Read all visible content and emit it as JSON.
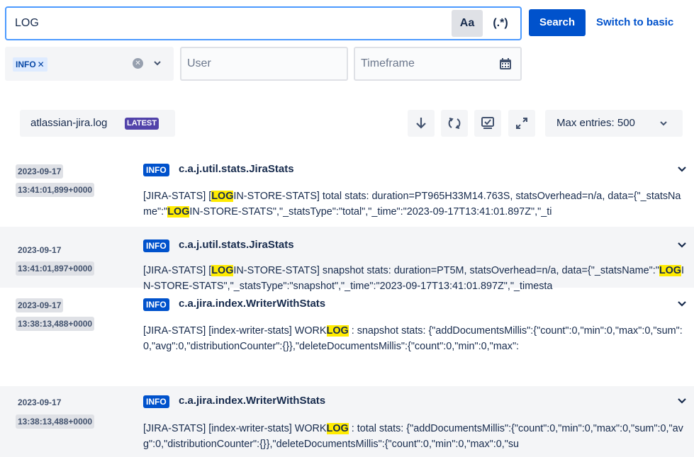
{
  "search": {
    "query": "LOG",
    "case_sensitive_label": "Aa",
    "regex_label": "(.*)",
    "search_button": "Search",
    "switch_link": "Switch to basic"
  },
  "filters": {
    "level_tag": "INFO",
    "level_tag_remove": "✕",
    "user_placeholder": "User",
    "timeframe_placeholder": "Timeframe"
  },
  "toolbar": {
    "file_name": "atlassian-jira.log",
    "latest_badge": "LATEST",
    "icons": [
      "download-icon",
      "refresh-icon",
      "monitor-icon",
      "expand-icon"
    ],
    "max_entries_label": "Max entries: 500"
  },
  "entries": [
    {
      "date": "2023-09-17",
      "time": "13:41:01,899+0000",
      "level": "INFO",
      "logger": "c.a.j.util.stats.JiraStats",
      "msg": {
        "a": "[JIRA-STATS] [",
        "b": "LOG",
        "c": "IN-STORE-STATS] total stats: duration=PT965H33M14.763S, statsOverhead=n/a, data={\"_statsName\":\"",
        "d": "LOG",
        "e": "IN-STORE-STATS\",\"_statsType\":\"total\",\"_time\":\"2023-09-17T13:41:01.897Z\",\"_ti"
      }
    },
    {
      "date": "2023-09-17",
      "time": "13:41:01,897+0000",
      "level": "INFO",
      "logger": "c.a.j.util.stats.JiraStats",
      "msg": {
        "a": "[JIRA-STATS] [",
        "b": "LOG",
        "c": "IN-STORE-STATS] snapshot stats: duration=PT5M, statsOverhead=n/a, data={\"_statsName\":\"",
        "d": "LOG",
        "e": "IN-STORE-STATS\",\"_statsType\":\"snapshot\",\"_time\":\"2023-09-17T13:41:01.897Z\",\"_timesta"
      }
    },
    {
      "date": "2023-09-17",
      "time": "13:38:13,488+0000",
      "level": "INFO",
      "logger": "c.a.jira.index.WriterWithStats",
      "msg": {
        "a": "[JIRA-STATS] [index-writer-stats] WORK",
        "b": "LOG",
        "c": " : snapshot stats: {\"addDocumentsMillis\":{\"count\":0,\"min\":0,\"max\":0,\"sum\":0,\"avg\":0,\"distributionCounter\":{}},\"deleteDocumentsMillis\":{\"count\":0,\"min\":0,\"max\":",
        "d": "",
        "e": ""
      }
    },
    {
      "date": "2023-09-17",
      "time": "13:38:13,488+0000",
      "level": "INFO",
      "logger": "c.a.jira.index.WriterWithStats",
      "msg": {
        "a": "[JIRA-STATS] [index-writer-stats] WORK",
        "b": "LOG",
        "c": " : total stats: {\"addDocumentsMillis\":{\"count\":0,\"min\":0,\"max\":0,\"sum\":0,\"avg\":0,\"distributionCounter\":{}},\"deleteDocumentsMillis\":{\"count\":0,\"min\":0,\"max\":0,\"su",
        "d": "",
        "e": ""
      }
    }
  ],
  "colors": {
    "primary": "#0052cc",
    "highlight": "#ffeb00",
    "latest_badge": "#5243aa",
    "focus_border": "#4c9aff"
  }
}
